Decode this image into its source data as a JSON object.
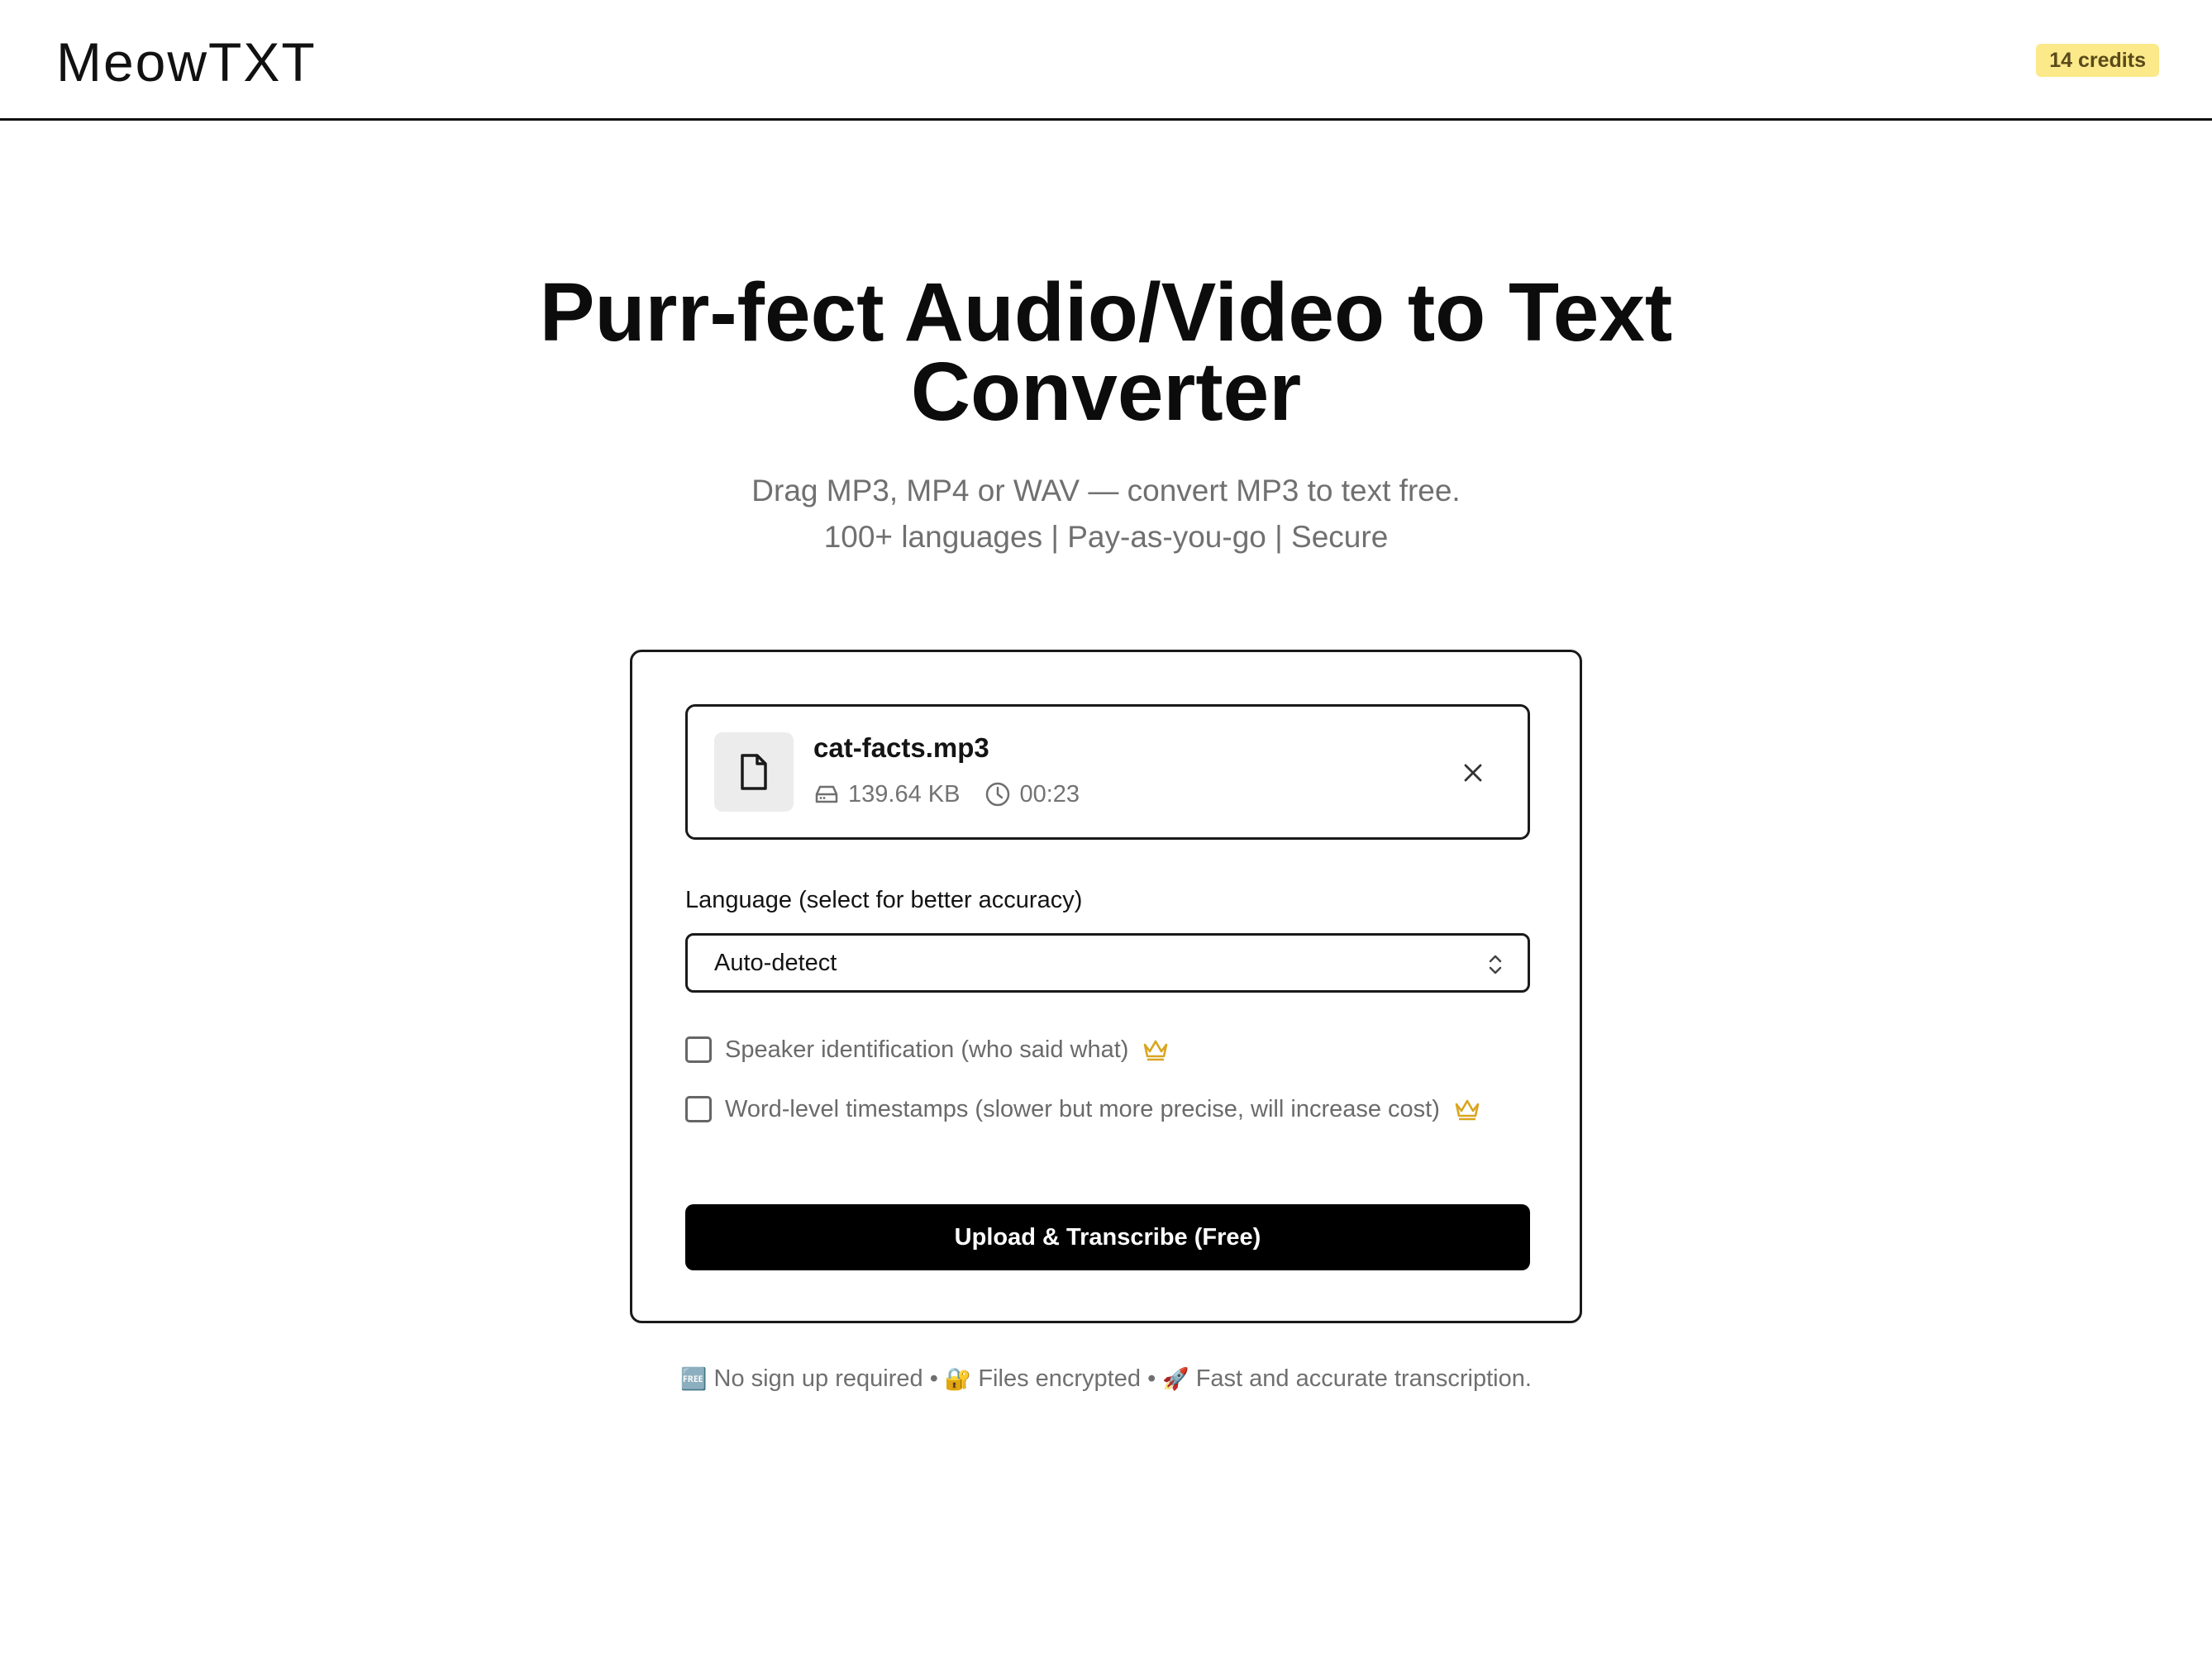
{
  "header": {
    "logo": "MeowTXT",
    "credits_badge": "14 credits",
    "badge_color": "#fbe98a"
  },
  "hero": {
    "title_line1": "Purr-fect Audio/Video to Text",
    "title_line2": "Converter",
    "subtitle_line1": "Drag MP3, MP4 or WAV — convert MP3 to text free.",
    "subtitle_line2": "100+ languages | Pay-as-you-go | Secure"
  },
  "file": {
    "icon": "document-icon",
    "name": "cat-facts.mp3",
    "size": "139.64 KB",
    "size_icon": "drive-icon",
    "duration": "00:23",
    "duration_icon": "clock-icon",
    "remove_icon": "close-icon"
  },
  "language": {
    "label": "Language (select for better accuracy)",
    "selected": "Auto-detect"
  },
  "options": [
    {
      "label": "Speaker identification (who said what)",
      "checked": false,
      "premium_icon": "crown-icon"
    },
    {
      "label": "Word-level timestamps (slower but more precise, will increase cost)",
      "checked": false,
      "premium_icon": "crown-icon"
    }
  ],
  "cta": {
    "label": "Upload & Transcribe (Free)"
  },
  "footer": {
    "emoji1": "🆓",
    "text1": "No sign up required",
    "sep": "•",
    "emoji2": "🔐",
    "text2": "Files encrypted",
    "emoji3": "🚀",
    "text3": "Fast and accurate transcription."
  },
  "colors": {
    "accent_black": "#000000",
    "crown_gold": "#d9a520"
  }
}
